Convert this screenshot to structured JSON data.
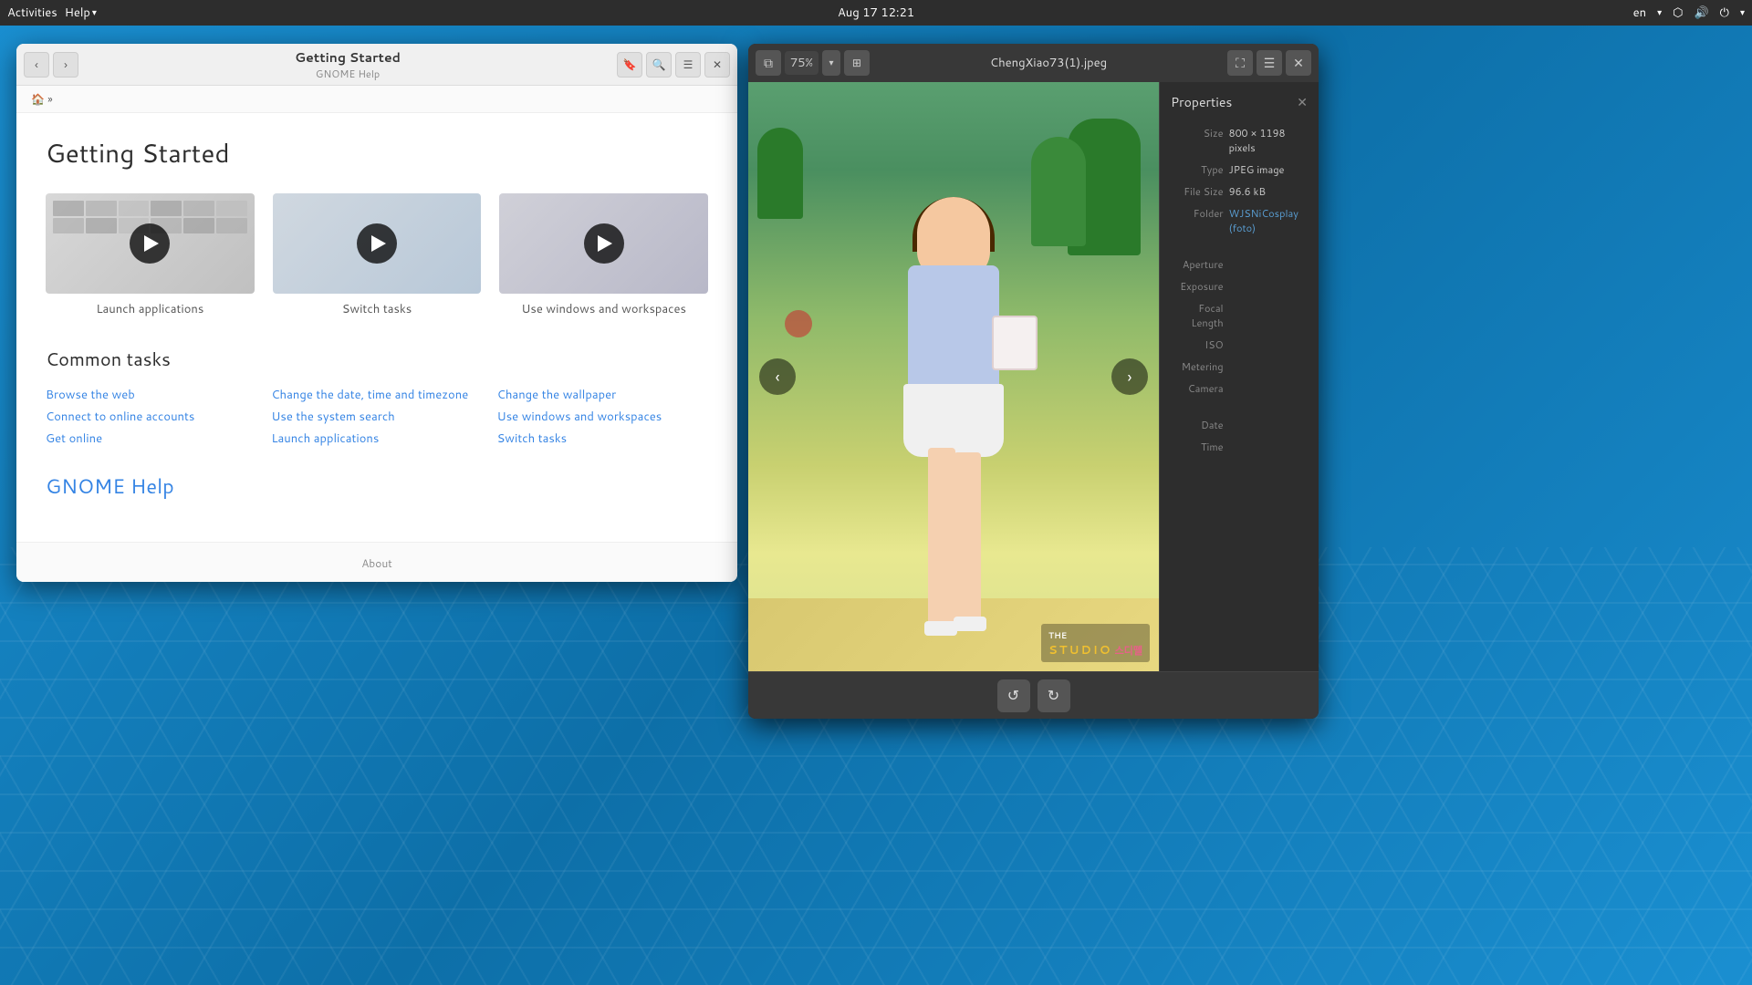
{
  "topbar": {
    "activities": "Activities",
    "help_menu": "Help",
    "help_arrow": "▾",
    "datetime": "Aug 17  12:21",
    "language": "en",
    "network_icon": "network",
    "sound_icon": "sound",
    "power_icon": "power",
    "arrow_down": "▾"
  },
  "help_window": {
    "title": "Getting Started",
    "subtitle": "GNOME Help",
    "page_title": "Getting Started",
    "breadcrumb": "🏠 »",
    "nav_back": "‹",
    "nav_forward": "›",
    "btn_bookmark": "🔖",
    "btn_search": "🔍",
    "btn_menu": "☰",
    "btn_close": "✕",
    "videos": [
      {
        "label": "Launch applications",
        "id": "launch"
      },
      {
        "label": "Switch tasks",
        "id": "switch"
      },
      {
        "label": "Use windows and workspaces",
        "id": "workspaces"
      }
    ],
    "common_tasks_title": "Common tasks",
    "tasks": [
      {
        "col": 0,
        "label": "Browse the web"
      },
      {
        "col": 1,
        "label": "Change the date, time and timezone"
      },
      {
        "col": 2,
        "label": "Change the wallpaper"
      },
      {
        "col": 0,
        "label": "Connect to online accounts"
      },
      {
        "col": 1,
        "label": "Use the system search"
      },
      {
        "col": 2,
        "label": "Use windows and workspaces"
      },
      {
        "col": 0,
        "label": "Get online"
      },
      {
        "col": 1,
        "label": "Launch applications"
      },
      {
        "col": 2,
        "label": "Switch tasks"
      }
    ],
    "gnome_help_link": "GNOME Help",
    "about_label": "About"
  },
  "image_window": {
    "title": "ChengXiao73(1).jpeg",
    "zoom": "75%",
    "btn_close": "✕",
    "btn_menu": "☰",
    "btn_fullscreen": "⛶",
    "btn_copy": "⧉",
    "nav_prev": "‹",
    "nav_next": "›",
    "btn_rotate_left": "↺",
    "btn_rotate_right": "↻",
    "properties_title": "Properties",
    "properties_close": "✕",
    "properties": {
      "size_label": "Size",
      "size_value": "800 × 1198 pixels",
      "type_label": "Type",
      "type_value": "JPEG image",
      "filesize_label": "File Size",
      "filesize_value": "96.6 kB",
      "folder_label": "Folder",
      "folder_value": "WJSNiCosplay (foto)",
      "aperture_label": "Aperture",
      "aperture_value": "",
      "exposure_label": "Exposure",
      "exposure_value": "",
      "focal_label": "Focal Length",
      "focal_value": "",
      "iso_label": "ISO",
      "iso_value": "",
      "metering_label": "Metering",
      "metering_value": "",
      "camera_label": "Camera",
      "camera_value": "",
      "date_label": "Date",
      "date_value": "",
      "time_label": "Time",
      "time_value": ""
    },
    "watermark_line1": "THE",
    "watermark_studio": "STUDIO",
    "watermark_korean": "스디뗄"
  }
}
